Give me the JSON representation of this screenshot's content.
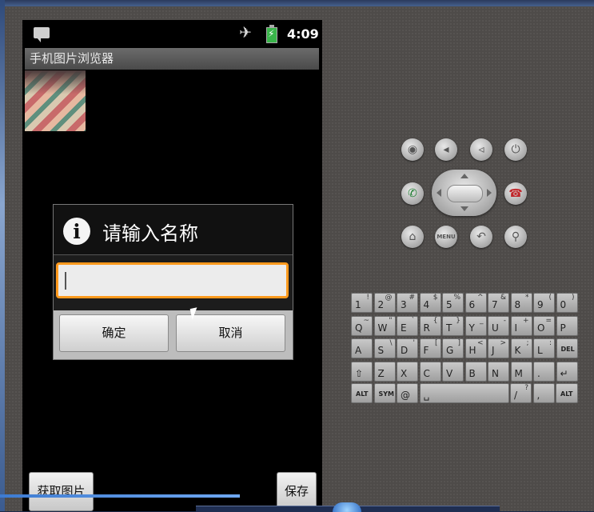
{
  "statusbar": {
    "time": "4:09",
    "icons": [
      "message-icon",
      "airplane-icon",
      "battery-charging-icon"
    ]
  },
  "app": {
    "title": "手机图片浏览器"
  },
  "dialog": {
    "icon": "info-icon",
    "title": "请输入名称",
    "input_value": "",
    "ok_label": "确定",
    "cancel_label": "取消"
  },
  "buttons": {
    "get_image": "获取图片",
    "save": "保存"
  },
  "hardware": {
    "menu_label": "MENU",
    "icons": [
      "camera-icon",
      "volume-down-icon",
      "volume-up-icon",
      "power-icon",
      "call-icon",
      "end-call-icon",
      "home-icon",
      "menu-icon",
      "back-icon",
      "search-icon"
    ]
  },
  "keyboard": {
    "rows": [
      [
        {
          "k": "1",
          "a": "!"
        },
        {
          "k": "2",
          "a": "@"
        },
        {
          "k": "3",
          "a": "#"
        },
        {
          "k": "4",
          "a": "$"
        },
        {
          "k": "5",
          "a": "%"
        },
        {
          "k": "6",
          "a": "^"
        },
        {
          "k": "7",
          "a": "&"
        },
        {
          "k": "8",
          "a": "*"
        },
        {
          "k": "9",
          "a": "("
        },
        {
          "k": "0",
          "a": ")"
        }
      ],
      [
        {
          "k": "Q",
          "a": "~"
        },
        {
          "k": "W",
          "a": "\""
        },
        {
          "k": "E",
          "a": "`"
        },
        {
          "k": "R",
          "a": "{"
        },
        {
          "k": "T",
          "a": "}"
        },
        {
          "k": "Y",
          "a": "_"
        },
        {
          "k": "U",
          "a": "-"
        },
        {
          "k": "I",
          "a": "+"
        },
        {
          "k": "O",
          "a": "="
        },
        {
          "k": "P",
          "a": ""
        }
      ],
      [
        {
          "k": "A",
          "a": ""
        },
        {
          "k": "S",
          "a": "\\"
        },
        {
          "k": "D",
          "a": "'"
        },
        {
          "k": "F",
          "a": "["
        },
        {
          "k": "G",
          "a": "]"
        },
        {
          "k": "H",
          "a": "<"
        },
        {
          "k": "J",
          "a": ">"
        },
        {
          "k": "K",
          "a": ";"
        },
        {
          "k": "L",
          "a": ":"
        },
        {
          "k": "DEL",
          "a": ""
        }
      ],
      [
        {
          "k": "⇧",
          "a": ""
        },
        {
          "k": "Z",
          "a": ""
        },
        {
          "k": "X",
          "a": ""
        },
        {
          "k": "C",
          "a": ""
        },
        {
          "k": "V",
          "a": ""
        },
        {
          "k": "B",
          "a": ""
        },
        {
          "k": "N",
          "a": ""
        },
        {
          "k": "M",
          "a": ""
        },
        {
          "k": ".",
          "a": ""
        },
        {
          "k": "↵",
          "a": ""
        }
      ],
      [
        {
          "k": "ALT",
          "a": ""
        },
        {
          "k": "SYM",
          "a": ""
        },
        {
          "k": "@",
          "a": ""
        },
        {
          "k": "␣",
          "a": ""
        },
        {
          "k": "/",
          "a": "?"
        },
        {
          "k": ",",
          "a": ""
        },
        {
          "k": "ALT",
          "a": ""
        }
      ]
    ]
  }
}
